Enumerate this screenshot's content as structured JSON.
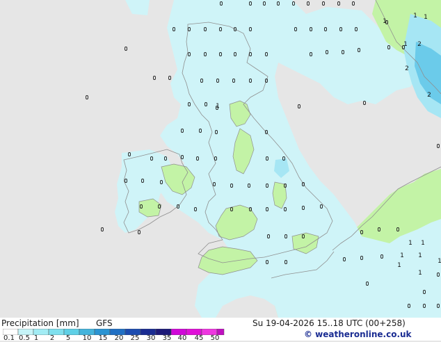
{
  "legend": {
    "title": "Precipitation [mm]",
    "model": "GFS",
    "valid_time": "Su 19-04-2026 15..18 UTC (00+258)",
    "brand": "© weatheronline.co.uk",
    "scale_labels": [
      "0.1",
      "0.5",
      "1",
      "2",
      "5",
      "10",
      "15",
      "20",
      "25",
      "30",
      "35",
      "40",
      "45",
      "50"
    ],
    "scale_colors": [
      "#ffffff",
      "#c6f4f8",
      "#a2ecf4",
      "#7fe0ee",
      "#5fd0e6",
      "#44b4dc",
      "#2b94d2",
      "#2170c4",
      "#1c4cb0",
      "#1a2c92",
      "#1d1978",
      "#d008d8",
      "#e010d8",
      "#ee36e0",
      "#c010c0"
    ]
  },
  "map": {
    "colors": {
      "sea": "#e6e6e6",
      "land": "#c3f3a6",
      "rain_light": "#cff4f8",
      "rain_mid": "#a6e6f4",
      "rain_heavy": "#6bcbea"
    },
    "cell_values": [
      "2",
      "2",
      "2",
      "1",
      "1",
      "1",
      "1",
      "1",
      "1",
      "1",
      "1",
      "1",
      "1",
      "1",
      "1"
    ]
  }
}
